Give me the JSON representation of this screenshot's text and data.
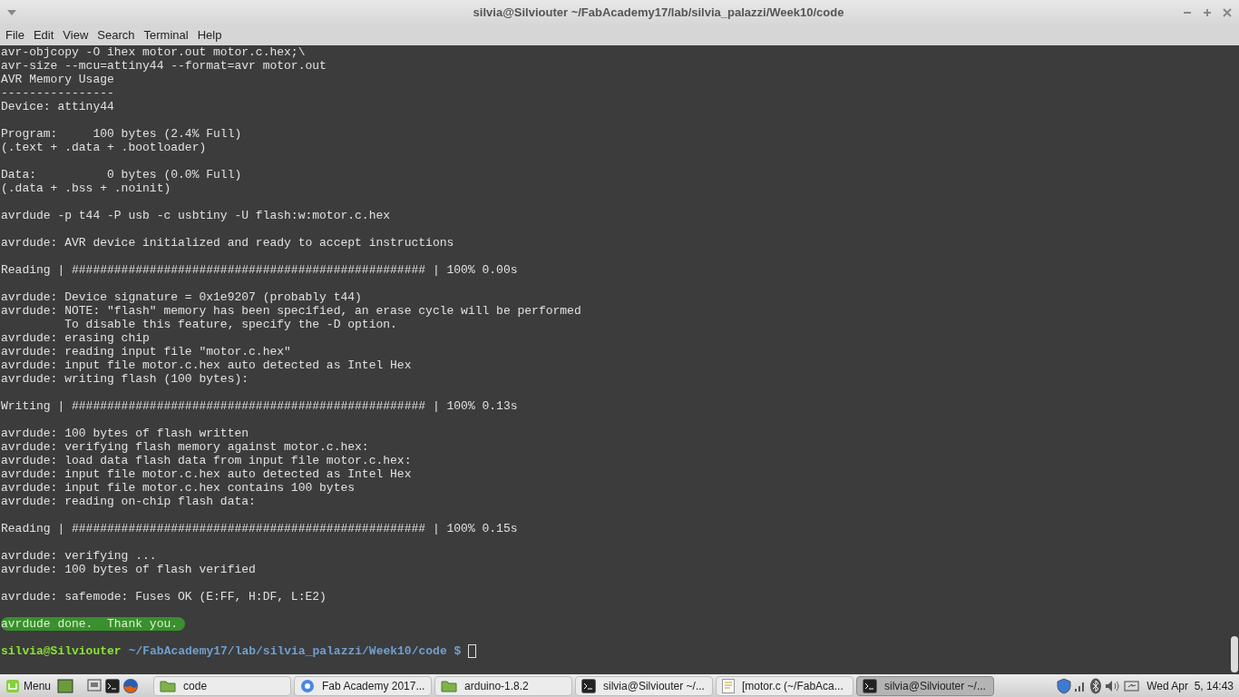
{
  "window": {
    "title": "silvia@Silviouter ~/FabAcademy17/lab/silvia_palazzi/Week10/code"
  },
  "menu": [
    "File",
    "Edit",
    "View",
    "Search",
    "Terminal",
    "Help"
  ],
  "terminal": {
    "blocks": [
      {
        "kind": "output",
        "lines": [
          "avr-objcopy -O ihex motor.out motor.c.hex;\\",
          "avr-size --mcu=attiny44 --format=avr motor.out",
          "AVR Memory Usage",
          "----------------",
          "Device: attiny44"
        ]
      },
      {
        "kind": "output",
        "lines": [
          "Program:     100 bytes (2.4% Full)",
          "(.text + .data + .bootloader)"
        ]
      },
      {
        "kind": "output",
        "lines": [
          "Data:          0 bytes (0.0% Full)",
          "(.data + .bss + .noinit)"
        ]
      },
      {
        "kind": "spacer"
      },
      {
        "kind": "output",
        "lines": [
          "avrdude -p t44 -P usb -c usbtiny -U flash:w:motor.c.hex"
        ]
      },
      {
        "kind": "output",
        "lines": [
          "avrdude: AVR device initialized and ready to accept instructions"
        ]
      },
      {
        "kind": "output",
        "lines": [
          "Reading | ################################################## | 100% 0.00s"
        ]
      },
      {
        "kind": "output",
        "lines": [
          "avrdude: Device signature = 0x1e9207 (probably t44)",
          "avrdude: NOTE: \"flash\" memory has been specified, an erase cycle will be performed",
          "         To disable this feature, specify the -D option.",
          "avrdude: erasing chip",
          "avrdude: reading input file \"motor.c.hex\"",
          "avrdude: input file motor.c.hex auto detected as Intel Hex",
          "avrdude: writing flash (100 bytes):"
        ]
      },
      {
        "kind": "output",
        "lines": [
          "Writing | ################################################## | 100% 0.13s"
        ]
      },
      {
        "kind": "output",
        "lines": [
          "avrdude: 100 bytes of flash written",
          "avrdude: verifying flash memory against motor.c.hex:",
          "avrdude: load data flash data from input file motor.c.hex:",
          "avrdude: input file motor.c.hex auto detected as Intel Hex",
          "avrdude: input file motor.c.hex contains 100 bytes",
          "avrdude: reading on-chip flash data:"
        ]
      },
      {
        "kind": "output",
        "lines": [
          "Reading | ################################################## | 100% 0.15s"
        ]
      },
      {
        "kind": "output",
        "lines": [
          "avrdude: verifying ...",
          "avrdude: 100 bytes of flash verified"
        ]
      },
      {
        "kind": "output",
        "lines": [
          "avrdude: safemode: Fuses OK (E:FF, H:DF, L:E2)"
        ]
      },
      {
        "kind": "highlighted",
        "lines": [
          "avrdude done.  Thank you."
        ]
      },
      {
        "kind": "prompt",
        "user": "silvia@Silviouter",
        "path": "~/FabAcademy17/lab/silvia_palazzi/Week10/code $"
      }
    ]
  },
  "taskbar": {
    "menu_label": "Menu",
    "windows": [
      {
        "kind": "folder",
        "label": "code",
        "selected": false
      },
      {
        "kind": "browser",
        "label": "Fab Academy 2017...",
        "selected": false
      },
      {
        "kind": "folder",
        "label": "arduino-1.8.2",
        "selected": false
      },
      {
        "kind": "terminal",
        "label": "silvia@Silviouter ~/...",
        "selected": false
      },
      {
        "kind": "editor",
        "label": "[motor.c (~/FabAca...",
        "selected": false
      },
      {
        "kind": "terminal",
        "label": "silvia@Silviouter ~/...",
        "selected": true
      }
    ],
    "clock": "Wed Apr  5, 14:43"
  }
}
